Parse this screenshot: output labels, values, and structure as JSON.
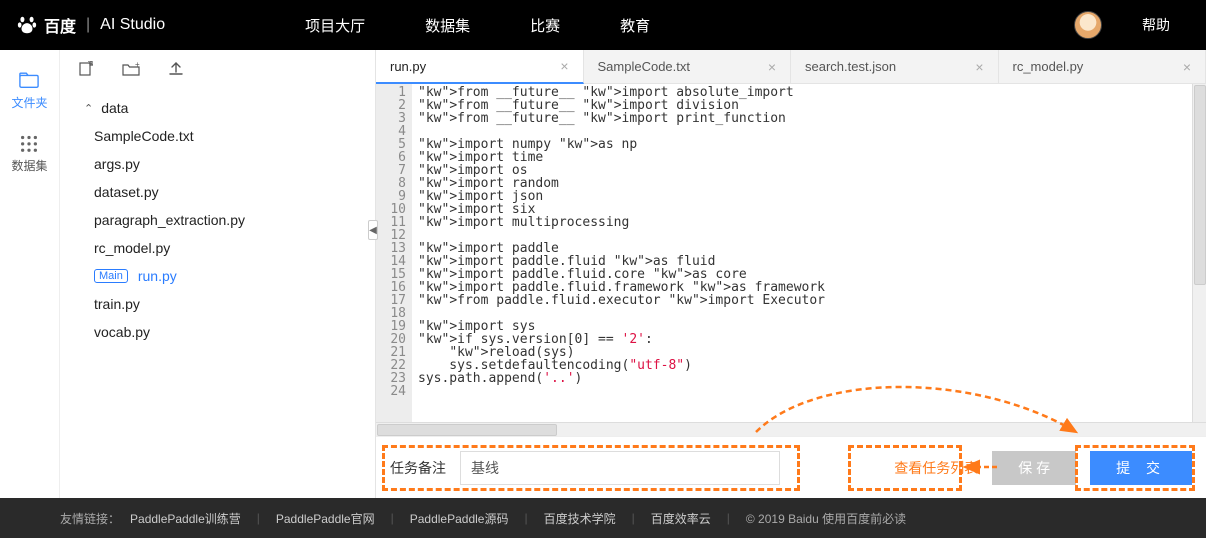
{
  "brand": {
    "baidu": "百度",
    "studio": "AI Studio"
  },
  "nav": [
    "项目大厅",
    "数据集",
    "比赛",
    "教育"
  ],
  "help": "帮助",
  "rail": [
    {
      "label": "文件夹",
      "active": true
    },
    {
      "label": "数据集",
      "active": false
    }
  ],
  "tree": {
    "folder": "data",
    "files": [
      "SampleCode.txt",
      "args.py",
      "dataset.py",
      "paragraph_extraction.py",
      "rc_model.py",
      "run.py",
      "train.py",
      "vocab.py"
    ],
    "main_badge": "Main",
    "active": "run.py"
  },
  "tabs": [
    {
      "label": "run.py",
      "active": true
    },
    {
      "label": "SampleCode.txt",
      "active": false
    },
    {
      "label": "search.test.json",
      "active": false
    },
    {
      "label": "rc_model.py",
      "active": false
    }
  ],
  "code": {
    "start": 1,
    "lines": [
      "from __future__ import absolute_import",
      "from __future__ import division",
      "from __future__ import print_function",
      "",
      "import numpy as np",
      "import time",
      "import os",
      "import random",
      "import json",
      "import six",
      "import multiprocessing",
      "",
      "import paddle",
      "import paddle.fluid as fluid",
      "import paddle.fluid.core as core",
      "import paddle.fluid.framework as framework",
      "from paddle.fluid.executor import Executor",
      "",
      "import sys",
      "if sys.version[0] == '2':",
      "    reload(sys)",
      "    sys.setdefaultencoding(\"utf-8\")",
      "sys.path.append('..')",
      ""
    ]
  },
  "task": {
    "label": "任务备注",
    "value": "基线",
    "view_list": "查看任务列表",
    "save": "保 存",
    "submit": "提 交"
  },
  "footer": {
    "label": "友情链接：",
    "links": [
      "PaddlePaddle训练营",
      "PaddlePaddle官网",
      "PaddlePaddle源码",
      "百度技术学院",
      "百度效率云"
    ],
    "copy": "© 2019 Baidu 使用百度前必读"
  }
}
